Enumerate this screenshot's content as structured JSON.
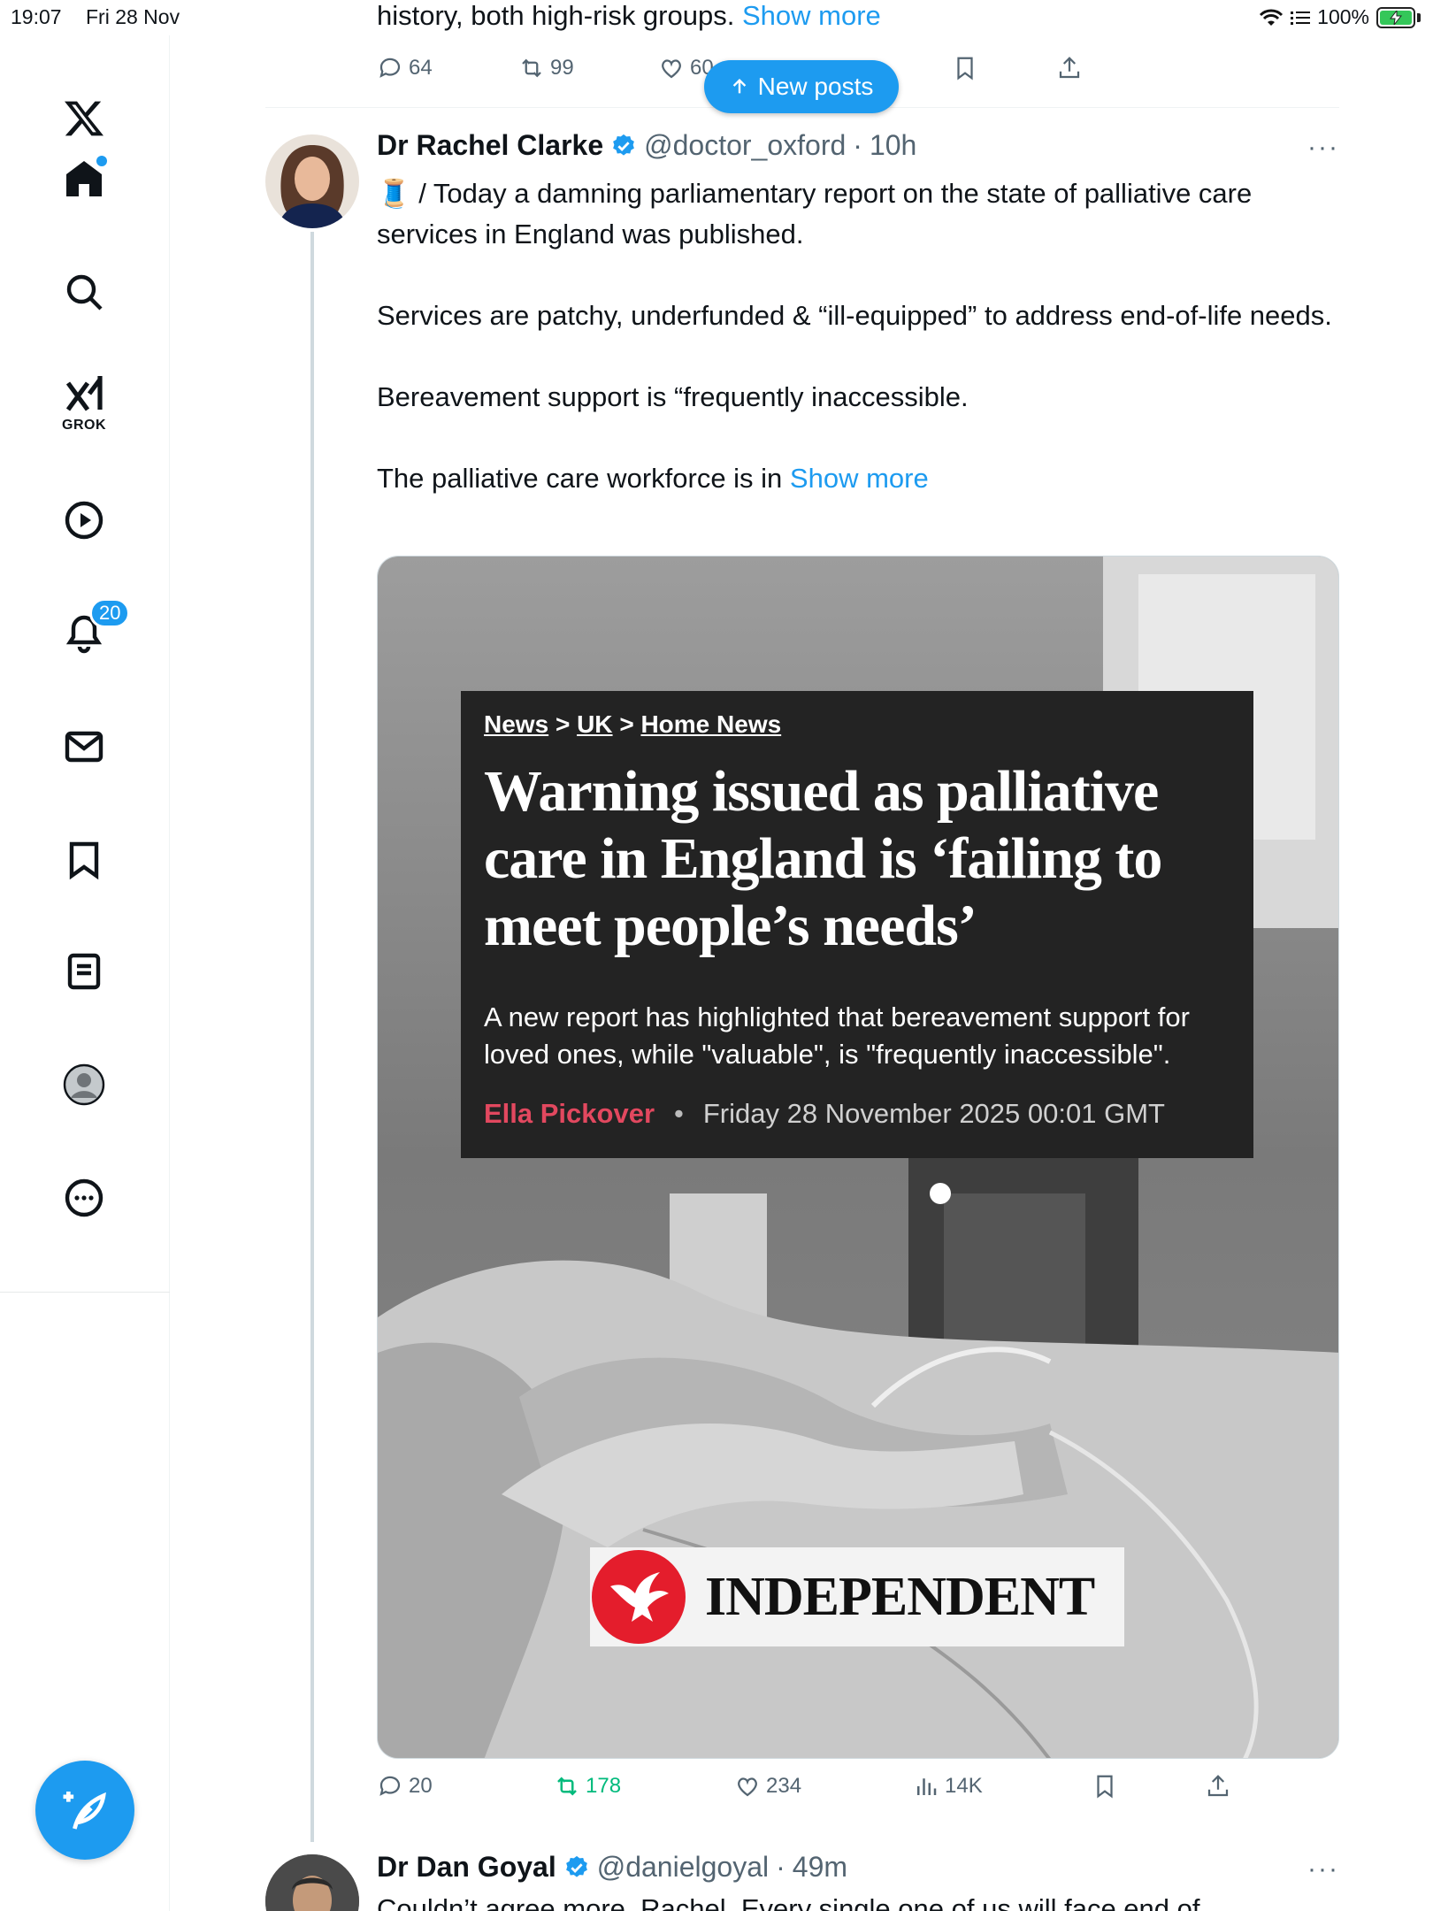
{
  "status_bar": {
    "time": "19:07",
    "date": "Fri 28 Nov",
    "battery": "100%"
  },
  "sidebar": {
    "notifications_badge": "20",
    "grok_label": "GROK"
  },
  "new_posts_label": "New posts",
  "prev_post": {
    "text": "history, both high-risk groups.",
    "show_more": "Show more",
    "replies": "64",
    "reposts": "99",
    "likes": "60"
  },
  "tweet": {
    "name": "Dr Rachel Clarke",
    "handle": "@doctor_oxford",
    "time": "10h",
    "more": "···",
    "body": [
      "🧵 / Today a damning parliamentary report on the state of palliative care services in England was published.",
      "Services are patchy, underfunded & “ill-equipped” to address end-of-life needs.",
      "Bereavement support is “frequently inaccessible."
    ],
    "last_line": "The palliative care workforce is in",
    "show_more": "Show more",
    "media": {
      "crumb1": "News",
      "crumb2": "UK",
      "crumb3": "Home News",
      "sep": ">",
      "headline": "Warning issued as palliative care in England is ‘failing to meet people’s needs’",
      "sub": "A new report has highlighted that bereavement support for loved ones, while \"valuable\", is \"frequently inaccessible\".",
      "author": "Ella Pickover",
      "bullet": "•",
      "date": "Friday 28 November 2025 00:01 GMT",
      "logo_text": "INDEPENDENT"
    },
    "actions": {
      "replies": "20",
      "reposts": "178",
      "likes": "234",
      "views": "14K"
    }
  },
  "reply": {
    "name": "Dr Dan Goyal",
    "handle": "@danielgoyal",
    "time": "49m",
    "more": "···",
    "text": "Couldn’t agree more, Rachel. Every single one of us will face end of"
  },
  "colors": {
    "accent": "#1d9bf0",
    "repost_green": "#00ba7c",
    "independent_red": "#e41d2c"
  }
}
